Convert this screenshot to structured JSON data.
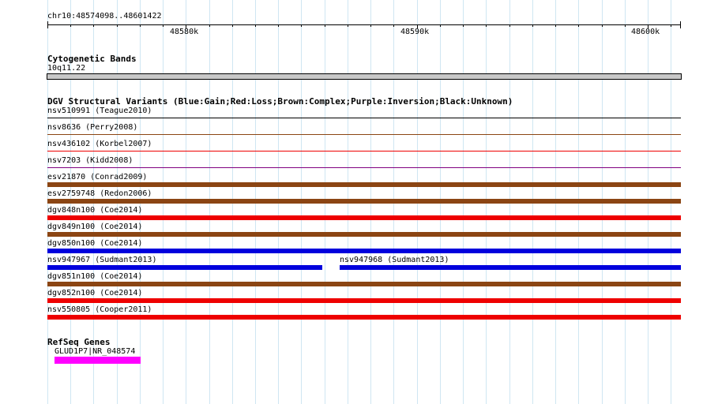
{
  "location": "chr10:48574098..48601422",
  "scale": {
    "labels": [
      "48580k",
      "48590k",
      "48600k"
    ]
  },
  "cytoband": {
    "title": "Cytogenetic Bands",
    "band": "10q11.22"
  },
  "dgv": {
    "title": "DGV Structural Variants (Blue:Gain;Red:Loss;Brown:Complex;Purple:Inversion;Black:Unknown)",
    "legend_colors": {
      "Gain": "#0000dd",
      "Loss": "#ee0000",
      "Complex": "#8b4513",
      "Inversion": "#800080",
      "Unknown": "#000000"
    },
    "features": [
      {
        "label": "nsv510991 (Teague2010)",
        "type": "Unknown"
      },
      {
        "label": "nsv8636 (Perry2008)",
        "type": "Complex"
      },
      {
        "label": "nsv436102 (Korbel2007)",
        "type": "Loss"
      },
      {
        "label": "nsv7203 (Kidd2008)",
        "type": "Inversion"
      },
      {
        "label": "esv21870 (Conrad2009)",
        "type": "Complex"
      },
      {
        "label": "esv2759748 (Redon2006)",
        "type": "Complex"
      },
      {
        "label": "dgv848n100 (Coe2014)",
        "type": "Loss"
      },
      {
        "label": "dgv849n100 (Coe2014)",
        "type": "Complex"
      },
      {
        "label": "dgv850n100 (Coe2014)",
        "type": "Gain"
      },
      {
        "label": "nsv947967 (Sudmant2013)",
        "type": "Gain"
      },
      {
        "label": "nsv947968 (Sudmant2013)",
        "type": "Gain"
      },
      {
        "label": "dgv851n100 (Coe2014)",
        "type": "Complex"
      },
      {
        "label": "dgv852n100 (Coe2014)",
        "type": "Loss"
      },
      {
        "label": "nsv550805 (Cooper2011)",
        "type": "Loss"
      }
    ]
  },
  "refseq": {
    "title": "RefSeq Genes",
    "gene_label": "GLUD1P7|NR_048574",
    "gene_color": "#ff00ff"
  }
}
